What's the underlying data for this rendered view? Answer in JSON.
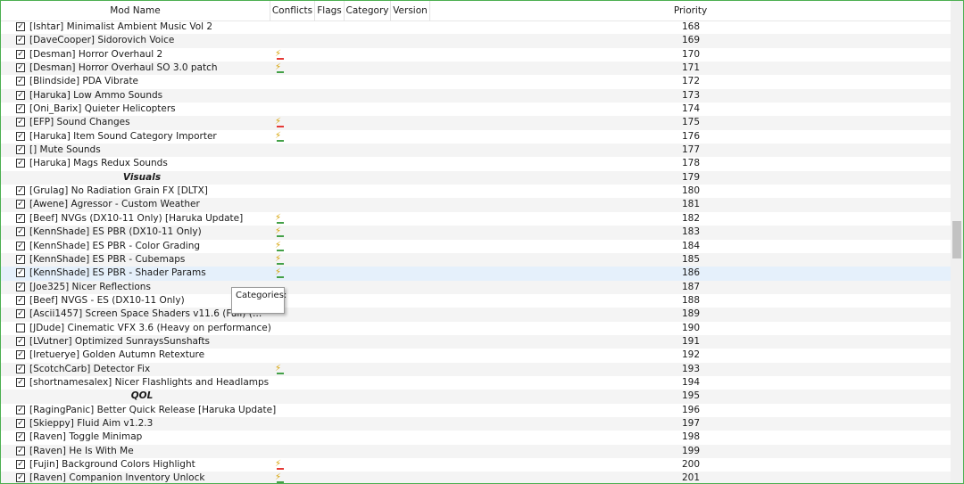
{
  "columns": {
    "mod_name": "Mod Name",
    "conflicts": "Conflicts",
    "flags": "Flags",
    "category": "Category",
    "version": "Version",
    "priority": "Priority"
  },
  "tooltip": "Categories:",
  "rows": [
    {
      "name": "[Ishtar] Minimalist Ambient Music Vol 2",
      "priority": "168",
      "checked": true,
      "conflict": ""
    },
    {
      "name": "[DaveCooper] Sidorovich Voice",
      "priority": "169",
      "checked": true,
      "conflict": ""
    },
    {
      "name": "[Desman] Horror Overhaul 2",
      "priority": "170",
      "checked": true,
      "conflict": "overwrite"
    },
    {
      "name": "[Desman] Horror Overhaul SO 3.0 patch",
      "priority": "171",
      "checked": true,
      "conflict": "both"
    },
    {
      "name": "[Blindside] PDA Vibrate",
      "priority": "172",
      "checked": true,
      "conflict": ""
    },
    {
      "name": "[Haruka] Low Ammo Sounds",
      "priority": "173",
      "checked": true,
      "conflict": ""
    },
    {
      "name": "[Oni_Barix] Quieter Helicopters",
      "priority": "174",
      "checked": true,
      "conflict": ""
    },
    {
      "name": "[EFP] Sound Changes",
      "priority": "175",
      "checked": true,
      "conflict": "overwrite"
    },
    {
      "name": "[Haruka] Item Sound Category Importer",
      "priority": "176",
      "checked": true,
      "conflict": "both"
    },
    {
      "name": "[] Mute Sounds",
      "priority": "177",
      "checked": true,
      "conflict": ""
    },
    {
      "name": "[Haruka] Mags Redux Sounds",
      "priority": "178",
      "checked": true,
      "conflict": ""
    },
    {
      "name": "Visuals",
      "priority": "179",
      "separator": true
    },
    {
      "name": "[Grulag] No Radiation Grain FX [DLTX]",
      "priority": "180",
      "checked": true,
      "conflict": ""
    },
    {
      "name": "[Awene] Agressor - Custom Weather",
      "priority": "181",
      "checked": true,
      "conflict": ""
    },
    {
      "name": "[Beef] NVGs (DX10-11 Only) [Haruka Update]",
      "priority": "182",
      "checked": true,
      "conflict": "both"
    },
    {
      "name": "[KennShade] ES PBR (DX10-11 Only)",
      "priority": "183",
      "checked": true,
      "conflict": "both"
    },
    {
      "name": "[KennShade] ES PBR - Color Grading",
      "priority": "184",
      "checked": true,
      "conflict": "both"
    },
    {
      "name": "[KennShade] ES PBR - Cubemaps",
      "priority": "185",
      "checked": true,
      "conflict": "both"
    },
    {
      "name": "[KennShade] ES PBR - Shader Params",
      "priority": "186",
      "checked": true,
      "conflict": "both",
      "selected": true
    },
    {
      "name": "[Joe325] Nicer Reflections",
      "priority": "187",
      "checked": true,
      "conflict": ""
    },
    {
      "name": "[Beef] NVGS - ES (DX10-11 Only)",
      "priority": "188",
      "checked": true,
      "conflict": ""
    },
    {
      "name": "[Ascii1457] Screen Space Shaders v11.6 (Full) (DX10-11 ...",
      "priority": "189",
      "checked": true,
      "conflict": "",
      "clip": true
    },
    {
      "name": "[JDude] Cinematic VFX 3.6 (Heavy on performance)",
      "priority": "190",
      "checked": false,
      "conflict": ""
    },
    {
      "name": "[LVutner] Optimized SunraysSunshafts",
      "priority": "191",
      "checked": true,
      "conflict": ""
    },
    {
      "name": "[Iretuerye] Golden Autumn Retexture",
      "priority": "192",
      "checked": true,
      "conflict": ""
    },
    {
      "name": "[ScotchCarb] Detector Fix",
      "priority": "193",
      "checked": true,
      "conflict": "both"
    },
    {
      "name": "[shortnamesalex] Nicer Flashlights and Headlamps",
      "priority": "194",
      "checked": true,
      "conflict": ""
    },
    {
      "name": "QOL",
      "priority": "195",
      "separator": true
    },
    {
      "name": "[RagingPanic] Better Quick Release [Haruka Update]",
      "priority": "196",
      "checked": true,
      "conflict": ""
    },
    {
      "name": "[Skieppy] Fluid Aim v1.2.3",
      "priority": "197",
      "checked": true,
      "conflict": ""
    },
    {
      "name": "[Raven] Toggle Minimap",
      "priority": "198",
      "checked": true,
      "conflict": ""
    },
    {
      "name": "[Raven] He Is With Me",
      "priority": "199",
      "checked": true,
      "conflict": ""
    },
    {
      "name": "[Fujin] Background Colors Highlight",
      "priority": "200",
      "checked": true,
      "conflict": "overwrite"
    },
    {
      "name": "[Raven] Companion Inventory Unlock",
      "priority": "201",
      "checked": true,
      "conflict": "both"
    }
  ],
  "colors": {
    "frame_border": "#4caf50",
    "alt_row": "#f4f4f4",
    "selected_row": "#e5f0fb",
    "conflict_overwrite": "#e53935",
    "conflict_both": "#43a047"
  }
}
